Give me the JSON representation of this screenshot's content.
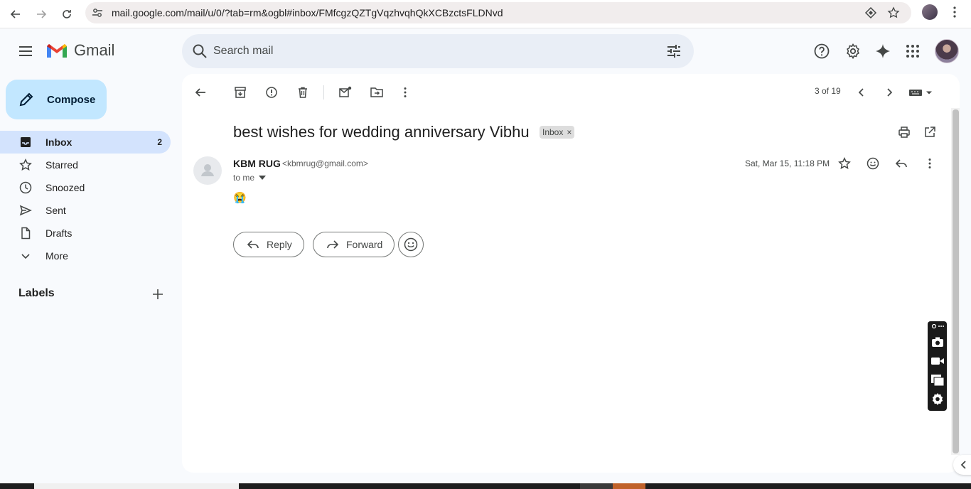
{
  "browser": {
    "url": "mail.google.com/mail/u/0/?tab=rm&ogbl#inbox/FMfcgzQZTgVqzhvqhQkXCBzctsFLDNvd"
  },
  "header": {
    "brand": "Gmail",
    "search_placeholder": "Search mail"
  },
  "sidebar": {
    "compose_label": "Compose",
    "items": [
      {
        "label": "Inbox",
        "count": "2",
        "icon": "inbox-icon",
        "active": true
      },
      {
        "label": "Starred",
        "icon": "star-icon"
      },
      {
        "label": "Snoozed",
        "icon": "clock-icon"
      },
      {
        "label": "Sent",
        "icon": "send-icon"
      },
      {
        "label": "Drafts",
        "icon": "draft-icon"
      },
      {
        "label": "More",
        "icon": "chevron-down-icon"
      }
    ],
    "labels_title": "Labels"
  },
  "toolbar": {
    "pager": "3 of 19"
  },
  "message": {
    "subject": "best wishes for wedding anniversary Vibhu",
    "label_chip": "Inbox",
    "chip_close": "×",
    "sender_name": "KBM RUG",
    "sender_email": "<kbmrug@gmail.com>",
    "recipient": "to me",
    "date": "Sat, Mar 15, 11:18 PM",
    "body": "😭"
  },
  "actions": {
    "reply": "Reply",
    "forward": "Forward"
  },
  "colors": {
    "compose_bg": "#c2e7ff",
    "active_nav_bg": "#d3e3fd",
    "page_bg": "#f8fafd",
    "search_bg": "#e9eef6"
  }
}
